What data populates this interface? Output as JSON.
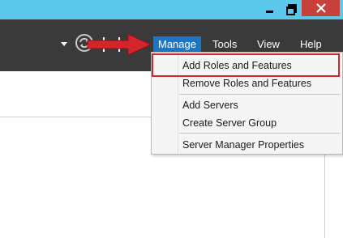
{
  "window": {
    "minimize_label": "minimize",
    "maximize_label": "restore",
    "close_label": "close"
  },
  "menubar": {
    "items": [
      {
        "label": "Manage",
        "active": true
      },
      {
        "label": "Tools",
        "active": false
      },
      {
        "label": "View",
        "active": false
      },
      {
        "label": "Help",
        "active": false
      }
    ],
    "icons": [
      "dropdown-arrow-icon",
      "refresh-icon",
      "flag-icon"
    ]
  },
  "manage_menu": {
    "groups": [
      [
        "Add Roles and Features",
        "Remove Roles and Features"
      ],
      [
        "Add Servers",
        "Create Server Group"
      ],
      [
        "Server Manager Properties"
      ]
    ],
    "highlighted": "Add Roles and Features"
  },
  "colors": {
    "titlebar": "#5bc8ec",
    "menubar": "#3a3a3a",
    "active_menu": "#1a76c6",
    "annotation_red": "#d4252b",
    "close_button": "#c7403a"
  }
}
